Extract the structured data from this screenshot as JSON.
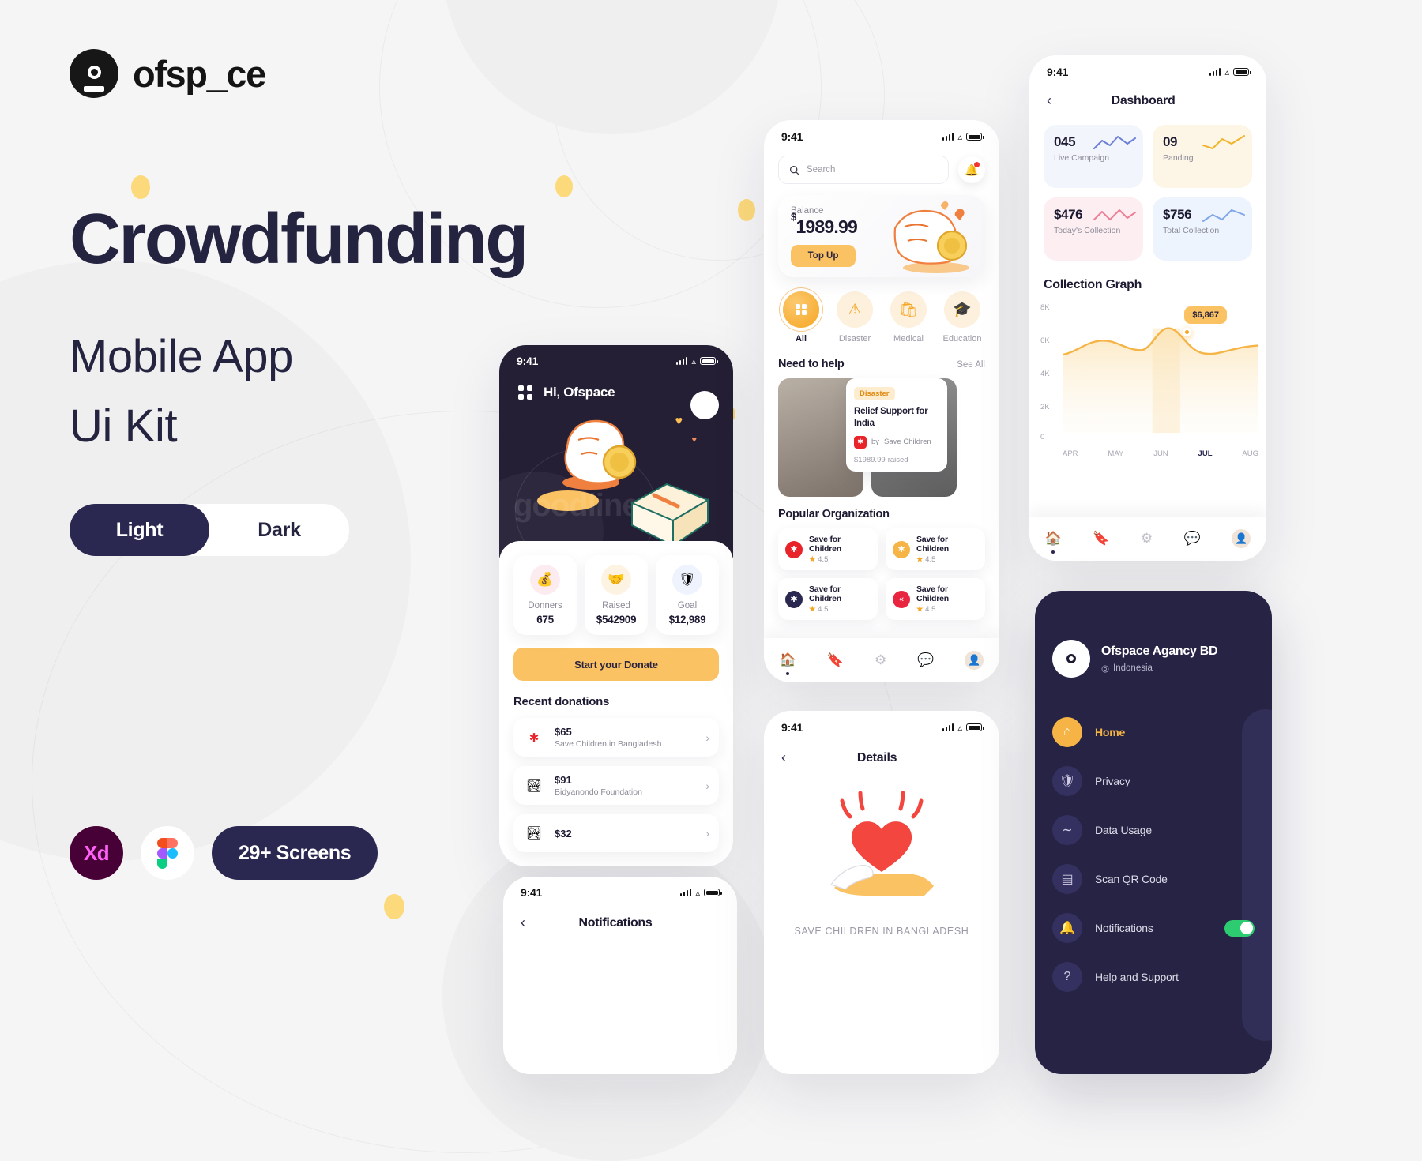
{
  "brand": {
    "logo_icon": "ofspace-logo-icon",
    "name": "ofsp_ce"
  },
  "hero": {
    "headline": "Crowdfunding",
    "subhead_line1": "Mobile App",
    "subhead_line2": "Ui Kit"
  },
  "theme_toggle": {
    "light": "Light",
    "dark": "Dark",
    "active": "Light"
  },
  "badges": {
    "xd": "Xd",
    "figma_icon": "figma-logo-icon",
    "screens": "29+ Screens"
  },
  "phone_home": {
    "status": {
      "time": "9:41"
    },
    "menu_icon": "grid-menu-icon",
    "greeting": "Hi, Ofspace",
    "avatar_icon": "avatar",
    "stats": [
      {
        "icon": "money-bag-icon",
        "label": "Donners",
        "value": "675"
      },
      {
        "icon": "hand-heart-icon",
        "label": "Raised",
        "value": "$542909"
      },
      {
        "icon": "shield-goal-icon",
        "label": "Goal",
        "value": "$12,989"
      }
    ],
    "cta": "Start your Donate",
    "recent_title": "Recent donations",
    "donations": [
      {
        "logo": "save-the-children-icon",
        "amount": "$65",
        "org": "Save Children in Bangladesh"
      },
      {
        "logo": "bidyanondo-icon",
        "amount": "$91",
        "org": "Bidyanondo Foundation"
      },
      {
        "logo": "bidyanondo-icon",
        "amount": "$32",
        "org": ""
      }
    ]
  },
  "phone_notifications": {
    "status": {
      "time": "9:41"
    },
    "back_icon": "chevron-left-icon",
    "title": "Notifications"
  },
  "phone_discover": {
    "status": {
      "time": "9:41"
    },
    "search": {
      "placeholder": "Search",
      "icon": "search-icon"
    },
    "bell_icon": "bell-icon",
    "balance": {
      "label": "Balance",
      "currency": "$",
      "value": "1989.99",
      "topup": "Top Up"
    },
    "categories": [
      {
        "icon": "grid-icon",
        "label": "All",
        "active": true
      },
      {
        "icon": "warning-icon",
        "label": "Disaster",
        "active": false
      },
      {
        "icon": "medical-kit-icon",
        "label": "Medical",
        "active": false
      },
      {
        "icon": "graduation-cap-icon",
        "label": "Education",
        "active": false
      }
    ],
    "need_help": {
      "title": "Need to help",
      "see_all": "See All"
    },
    "campaign": {
      "chip": "Disaster",
      "title": "Relief Support for India",
      "by_prefix": "by",
      "by": "Save Children",
      "currency": "$",
      "raised_value": "1989.99",
      "raised_label": "raised"
    },
    "popular_title": "Popular Organization",
    "organizations": [
      {
        "name": "Save for Children",
        "rating": "4.5",
        "color": "#e8242a",
        "glyph": "M"
      },
      {
        "name": "Save for Children",
        "rating": "4.5",
        "color": "#f5b445",
        "glyph": "g"
      },
      {
        "name": "Save for Children",
        "rating": "4.5",
        "color": "#2a2750",
        "glyph": "o"
      },
      {
        "name": "Save for Children",
        "rating": "4.5",
        "color": "#e8243f",
        "glyph": "«"
      }
    ],
    "tabs": [
      {
        "icon": "home-icon",
        "active": true
      },
      {
        "icon": "bookmark-icon",
        "active": false
      },
      {
        "icon": "gear-icon",
        "active": false
      },
      {
        "icon": "chat-icon",
        "active": false
      },
      {
        "icon": "profile-avatar-icon",
        "active": false
      }
    ]
  },
  "phone_details": {
    "status": {
      "time": "9:41"
    },
    "back_icon": "chevron-left-icon",
    "title": "Details",
    "illustration": "hand-holding-heart-illustration",
    "caption": "SAVE CHILDREN IN BANGLADESH"
  },
  "phone_dashboard": {
    "status": {
      "time": "9:41"
    },
    "back_icon": "chevron-left-icon",
    "title": "Dashboard",
    "kpis": [
      {
        "value": "045",
        "label": "Live Campaign",
        "bg": "#f3f5fd",
        "spark": "#6b7fd7"
      },
      {
        "value": "09",
        "label": "Panding",
        "bg": "#fdf5e6",
        "spark": "#f0b429"
      },
      {
        "value": "$476",
        "label": "Today's Collection",
        "bg": "#fdeef2",
        "spark": "#ec7f95"
      },
      {
        "value": "$756",
        "label": "Total Collection",
        "bg": "#eef4fd",
        "spark": "#7fa6e8"
      }
    ],
    "graph_title": "Collection Graph",
    "tooltip": "$6,867",
    "tabs": [
      {
        "icon": "home-icon",
        "active": true
      },
      {
        "icon": "bookmark-icon",
        "active": false
      },
      {
        "icon": "gear-icon",
        "active": false
      },
      {
        "icon": "chat-icon",
        "active": false
      },
      {
        "icon": "profile-avatar-icon",
        "active": false
      }
    ]
  },
  "chart_data": {
    "type": "line",
    "title": "Collection Graph",
    "xlabel": "",
    "ylabel": "",
    "categories": [
      "APR",
      "MAY",
      "JUN",
      "JUL",
      "AUG"
    ],
    "tick_labels_y": [
      "0",
      "2K",
      "4K",
      "6K",
      "8K"
    ],
    "ylim": [
      0,
      8000
    ],
    "values": [
      5000,
      6100,
      5200,
      6867,
      5600
    ],
    "highlight": {
      "category": "JUL",
      "value": 6867,
      "label": "$6,867"
    },
    "grid": false,
    "legend": "none",
    "line_color": "#f5b445",
    "area_fill": "#fdf1dc"
  },
  "sidebar_menu": {
    "account": {
      "name": "Ofspace Agancy BD",
      "location": "Indonesia",
      "location_icon": "pin-icon",
      "avatar_icon": "ofspace-avatar-icon"
    },
    "items": [
      {
        "icon": "home-icon",
        "label": "Home",
        "active": true
      },
      {
        "icon": "shield-check-icon",
        "label": "Privacy",
        "active": false
      },
      {
        "icon": "activity-icon",
        "label": "Data Usage",
        "active": false
      },
      {
        "icon": "qr-code-icon",
        "label": "Scan QR Code",
        "active": false
      },
      {
        "icon": "bell-icon",
        "label": "Notifications",
        "active": false,
        "toggle": true,
        "toggle_on": true
      },
      {
        "icon": "help-icon",
        "label": "Help and Support",
        "active": false
      }
    ]
  }
}
